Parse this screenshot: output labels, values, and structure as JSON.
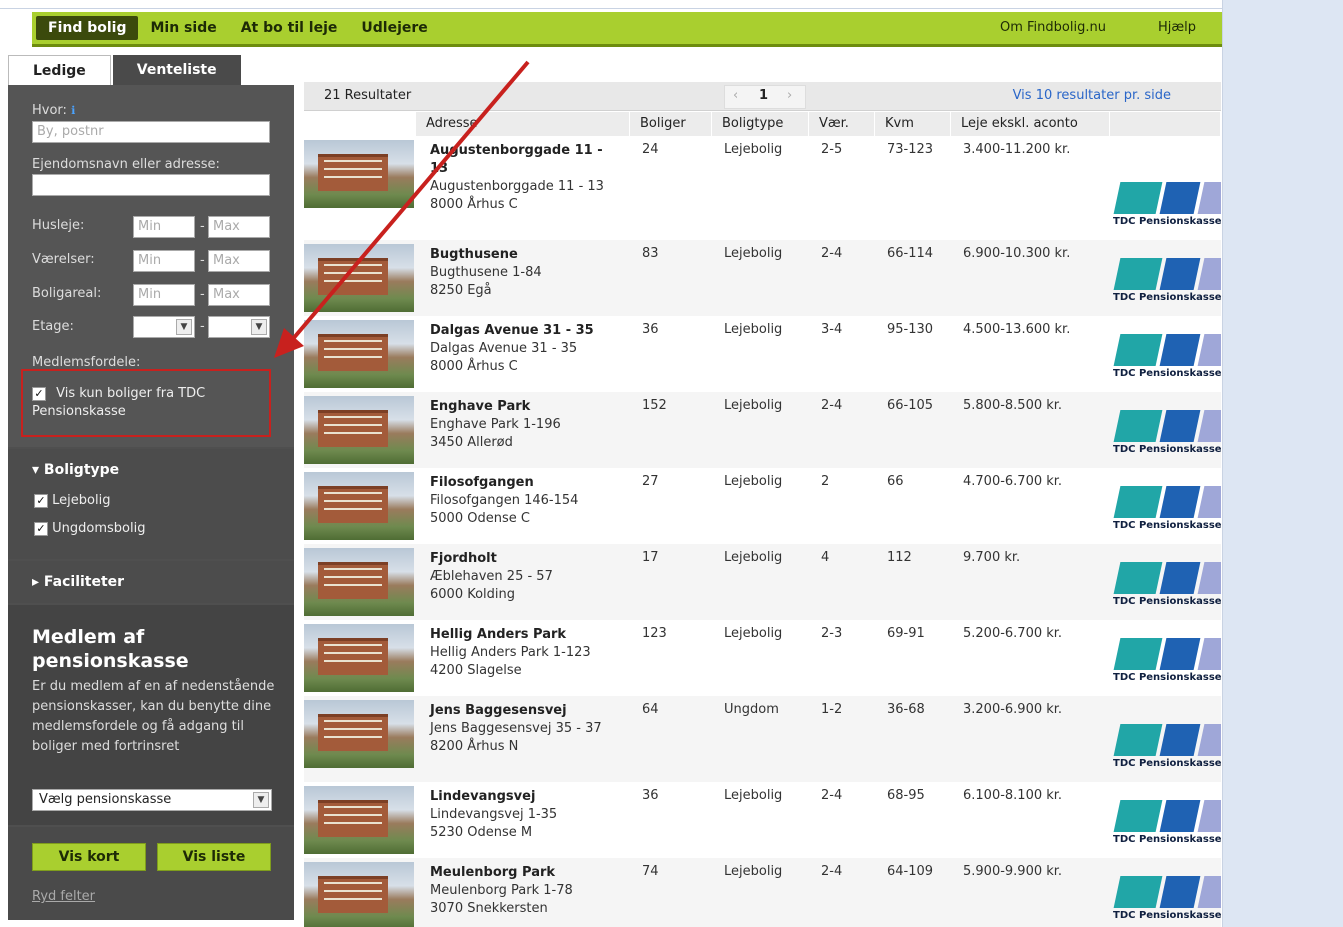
{
  "topnav": {
    "items": [
      "Find bolig",
      "Min side",
      "At bo til leje",
      "Udlejere"
    ],
    "right": [
      "Om Findbolig.nu",
      "Hjælp"
    ]
  },
  "tabs": [
    "Ledige",
    "Venteliste"
  ],
  "filters": {
    "hvor_label": "Hvor:",
    "hvor_placeholder": "By, postnr",
    "ejendom_label": "Ejendomsnavn eller adresse:",
    "husleje_label": "Husleje:",
    "vaerelser_label": "Værelser:",
    "boligareal_label": "Boligareal:",
    "etage_label": "Etage:",
    "min": "Min",
    "max": "Max",
    "medlemsfordele_label": "Medlemsfordele:",
    "vis_kun_label": "Vis kun boliger fra TDC Pensionskasse"
  },
  "boligtype": {
    "header": "Boligtype",
    "options": [
      "Lejebolig",
      "Ungdomsbolig"
    ]
  },
  "faciliteter": {
    "header": "Faciliteter"
  },
  "pension": {
    "title": "Medlem af pensionskasse",
    "text": "Er du medlem af en af nedenstående pensionskasser, kan du benytte dine medlemsfordele og få adgang til boliger med fortrinsret",
    "select": "Vælg pensionskasse"
  },
  "buttons": {
    "vis_kort": "Vis kort",
    "vis_liste": "Vis liste",
    "ryd": "Ryd felter"
  },
  "results": {
    "count": "21 Resultater",
    "page": "1",
    "perpage": "Vis 10 resultater pr. side",
    "columns": [
      "Adresse",
      "Boliger",
      "Boligtype",
      "Vær.",
      "Kvm",
      "Leje ekskl. aconto"
    ],
    "logo_text": "TDC Pensionskasse",
    "rows": [
      {
        "name": "Augustenborggade 11 - 13",
        "addr1": "Augustenborggade 11 - 13",
        "addr2": "8000 Århus C",
        "boliger": "24",
        "type": "Lejebolig",
        "vaer": "2-5",
        "kvm": "73-123",
        "leje": "3.400-11.200 kr."
      },
      {
        "name": "Bugthusene",
        "addr1": "Bugthusene 1-84",
        "addr2": "8250 Egå",
        "boliger": "83",
        "type": "Lejebolig",
        "vaer": "2-4",
        "kvm": "66-114",
        "leje": "6.900-10.300 kr."
      },
      {
        "name": "Dalgas Avenue 31 - 35",
        "addr1": "Dalgas Avenue 31 - 35",
        "addr2": "8000 Århus C",
        "boliger": "36",
        "type": "Lejebolig",
        "vaer": "3-4",
        "kvm": "95-130",
        "leje": "4.500-13.600 kr."
      },
      {
        "name": "Enghave Park",
        "addr1": "Enghave Park 1-196",
        "addr2": "3450 Allerød",
        "boliger": "152",
        "type": "Lejebolig",
        "vaer": "2-4",
        "kvm": "66-105",
        "leje": "5.800-8.500 kr."
      },
      {
        "name": "Filosofgangen",
        "addr1": "Filosofgangen 146-154",
        "addr2": "5000 Odense C",
        "boliger": "27",
        "type": "Lejebolig",
        "vaer": "2",
        "kvm": "66",
        "leje": "4.700-6.700 kr."
      },
      {
        "name": "Fjordholt",
        "addr1": "Æblehaven 25 - 57",
        "addr2": "6000 Kolding",
        "boliger": "17",
        "type": "Lejebolig",
        "vaer": "4",
        "kvm": "112",
        "leje": "9.700 kr."
      },
      {
        "name": "Hellig Anders Park",
        "addr1": "Hellig Anders Park 1-123",
        "addr2": "4200 Slagelse",
        "boliger": "123",
        "type": "Lejebolig",
        "vaer": "2-3",
        "kvm": "69-91",
        "leje": "5.200-6.700 kr."
      },
      {
        "name": "Jens Baggesensvej",
        "addr1": "Jens Baggesensvej 35 - 37",
        "addr2": "8200 Århus N",
        "boliger": "64",
        "type": "Ungdom",
        "vaer": "1-2",
        "kvm": "36-68",
        "leje": "3.200-6.900 kr."
      },
      {
        "name": "Lindevangsvej",
        "addr1": "Lindevangsvej 1-35",
        "addr2": "5230 Odense M",
        "boliger": "36",
        "type": "Lejebolig",
        "vaer": "2-4",
        "kvm": "68-95",
        "leje": "6.100-8.100 kr."
      },
      {
        "name": "Meulenborg Park",
        "addr1": "Meulenborg Park 1-78",
        "addr2": "3070 Snekkersten",
        "boliger": "74",
        "type": "Lejebolig",
        "vaer": "2-4",
        "kvm": "64-109",
        "leje": "5.900-9.900 kr."
      }
    ]
  }
}
